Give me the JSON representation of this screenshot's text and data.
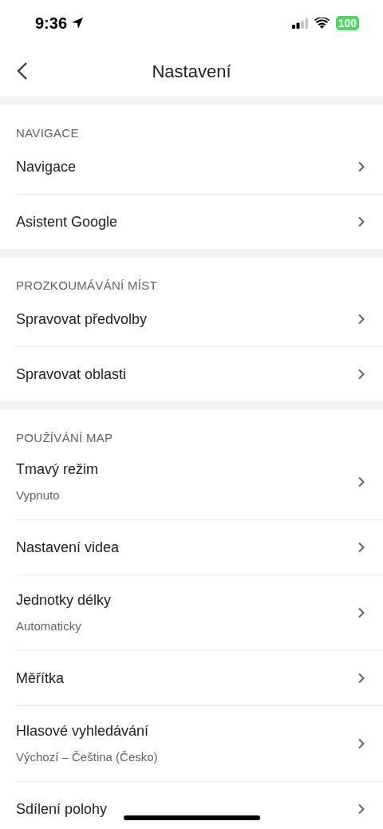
{
  "status_bar": {
    "time": "9:36",
    "battery": "100"
  },
  "header": {
    "title": "Nastavení"
  },
  "sections": [
    {
      "title": "NAVIGACE",
      "items": [
        {
          "label": "Navigace"
        },
        {
          "label": "Asistent Google"
        }
      ]
    },
    {
      "title": "PROZKOUMÁVÁNÍ MÍST",
      "items": [
        {
          "label": "Spravovat předvolby"
        },
        {
          "label": "Spravovat oblasti"
        }
      ]
    },
    {
      "title": "POUŽÍVÁNÍ MAP",
      "items": [
        {
          "label": "Tmavý režim",
          "sublabel": "Vypnuto"
        },
        {
          "label": "Nastavení videa"
        },
        {
          "label": "Jednotky délky",
          "sublabel": "Automaticky"
        },
        {
          "label": "Měřítka"
        },
        {
          "label": "Hlasové vyhledávání",
          "sublabel": "Výchozí – Čeština (Česko)"
        },
        {
          "label": "Sdílení polohy"
        }
      ]
    }
  ]
}
